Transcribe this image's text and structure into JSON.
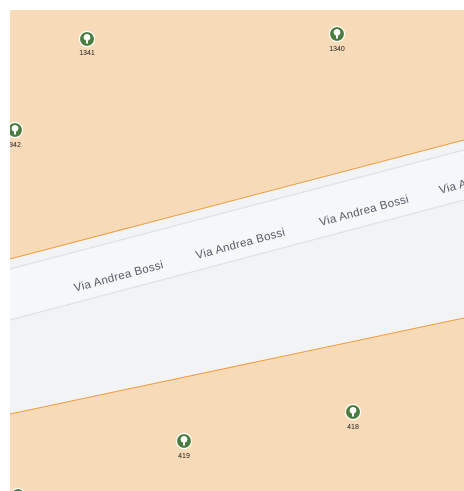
{
  "map": {
    "colors": {
      "land": "#f7dbb8",
      "road_surface": "#f1f3f5",
      "road_casing": "#dde1e6",
      "landuse_edge": "#f09a3e",
      "tree_marker": "#4a7c3f"
    },
    "street": {
      "name": "Via Andrea Bossi",
      "label_fragments": [
        "ssi",
        "Via Andrea Bossi",
        "Via Andrea Bossi",
        "Via Andrea Bossi",
        "Via And"
      ]
    },
    "tree_markers": [
      {
        "id": "1341",
        "icon": "tree-icon"
      },
      {
        "id": "1340",
        "icon": "tree-icon"
      },
      {
        "id": "342",
        "icon": "tree-icon"
      },
      {
        "id": "418",
        "icon": "tree-icon"
      },
      {
        "id": "419",
        "icon": "tree-icon"
      },
      {
        "id": "",
        "icon": "tree-icon"
      }
    ]
  }
}
